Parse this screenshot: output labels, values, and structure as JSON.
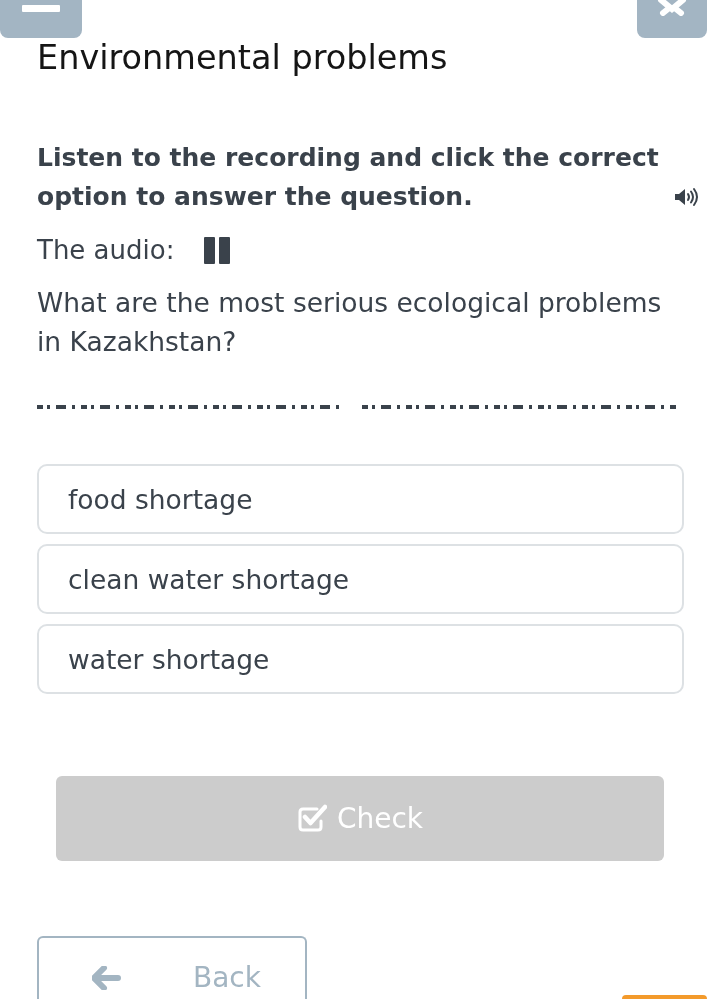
{
  "header": {
    "title": "Environmental problems"
  },
  "task": {
    "instruction": "Listen to the recording and click the correct option to answer the question.",
    "audio_label": "The audio:",
    "audio_playing": true,
    "question": "What are the most serious ecological problems in Kazakhstan?"
  },
  "options": [
    {
      "label": "food shortage",
      "selected": false
    },
    {
      "label": "clean water shortage",
      "selected": false
    },
    {
      "label": "water shortage",
      "selected": false
    }
  ],
  "check_button": {
    "label": "Check",
    "disabled": true
  },
  "back_button": {
    "label": "Back"
  }
}
